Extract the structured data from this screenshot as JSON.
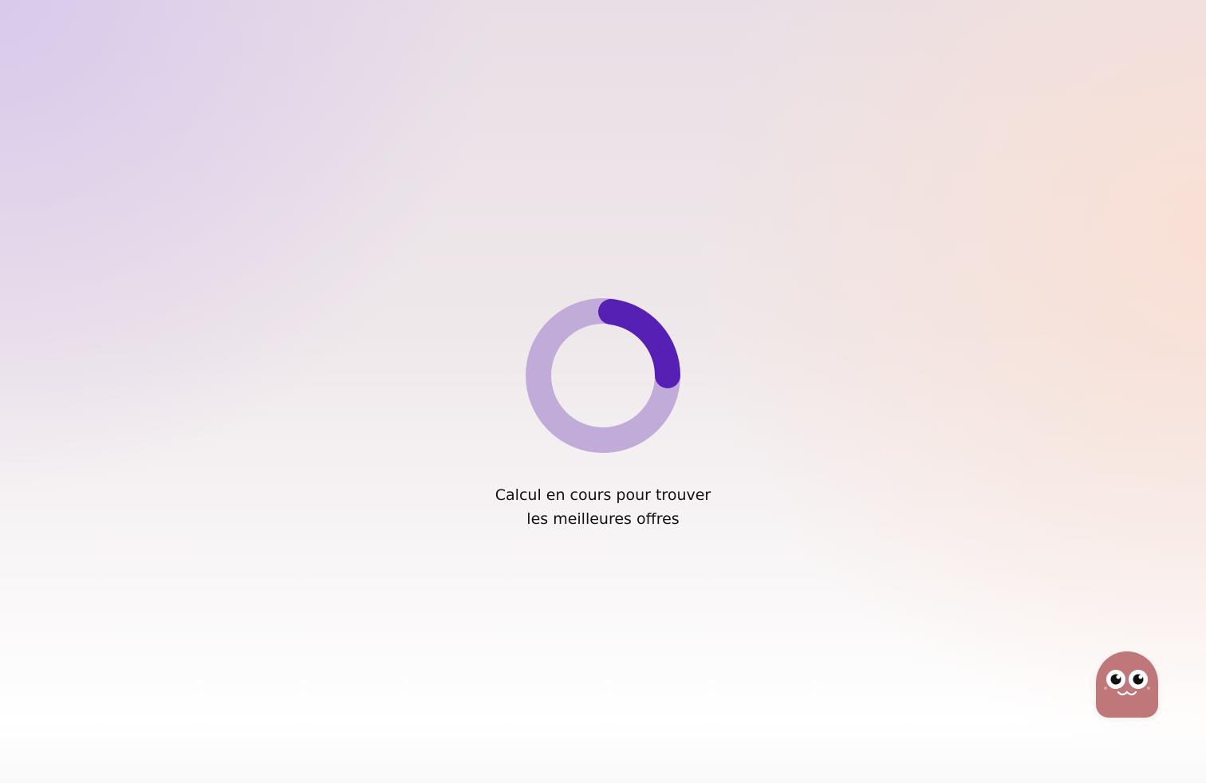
{
  "loader": {
    "message_line1": "Calcul en cours pour trouver",
    "message_line2": "les meilleures offres",
    "progress_fraction": 0.23,
    "colors": {
      "track": "#c1acd9",
      "arc": "#5620b4"
    }
  },
  "chat_widget": {
    "icon": "mascot-icon",
    "color": "#c0777a"
  }
}
